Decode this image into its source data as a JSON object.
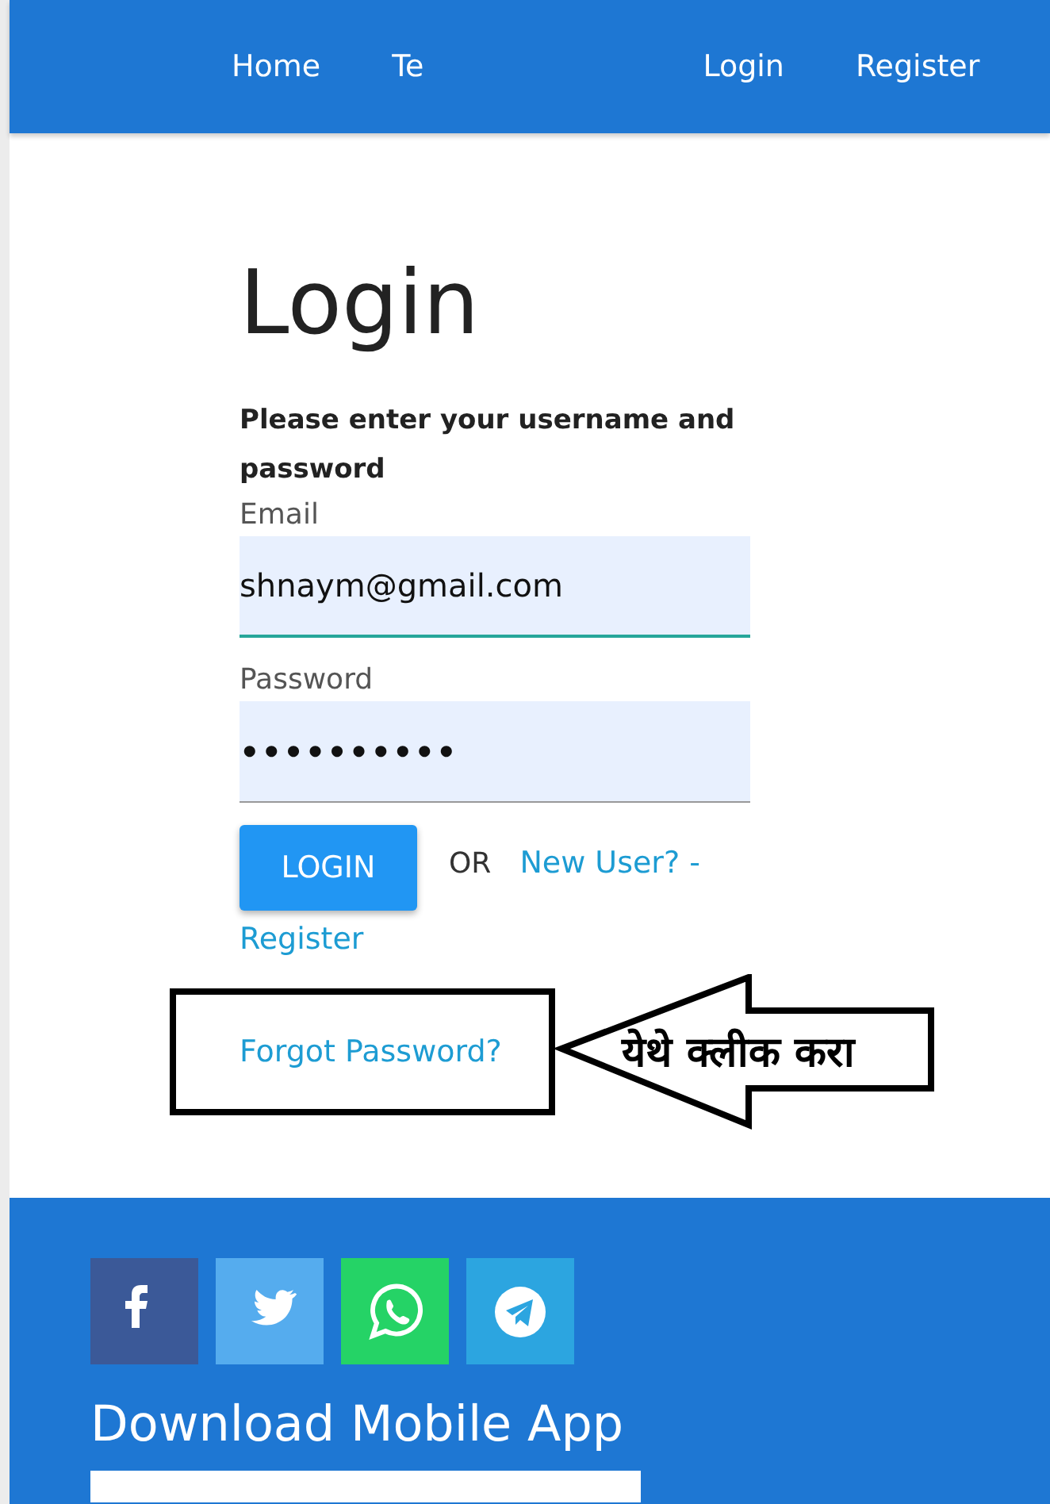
{
  "navbar": {
    "items": [
      {
        "label": "Home"
      },
      {
        "label": "Te"
      },
      {
        "label": "Login"
      },
      {
        "label": "Register"
      }
    ]
  },
  "login": {
    "title": "Login",
    "subtitle": "Please enter your username and password",
    "fields": [
      {
        "label": "Email",
        "value": "shnaym@gmail.com",
        "focused": true
      },
      {
        "label": "Password",
        "value": "••••••••••",
        "focused": false
      }
    ],
    "login_button": "LOGIN",
    "or_text": "OR",
    "register_link": [
      "New User? -",
      "Register"
    ],
    "forgot_link": "Forgot Password?"
  },
  "annotation": {
    "text": "येथे क्लीक करा"
  },
  "footer": {
    "social": [
      {
        "kind": "facebook",
        "color": "#3b5998"
      },
      {
        "kind": "twitter",
        "color": "#55acee"
      },
      {
        "kind": "whatsapp",
        "color": "#25d366"
      },
      {
        "kind": "telegram",
        "color": "#2ca5e0"
      }
    ],
    "heading": "Download Mobile App"
  }
}
